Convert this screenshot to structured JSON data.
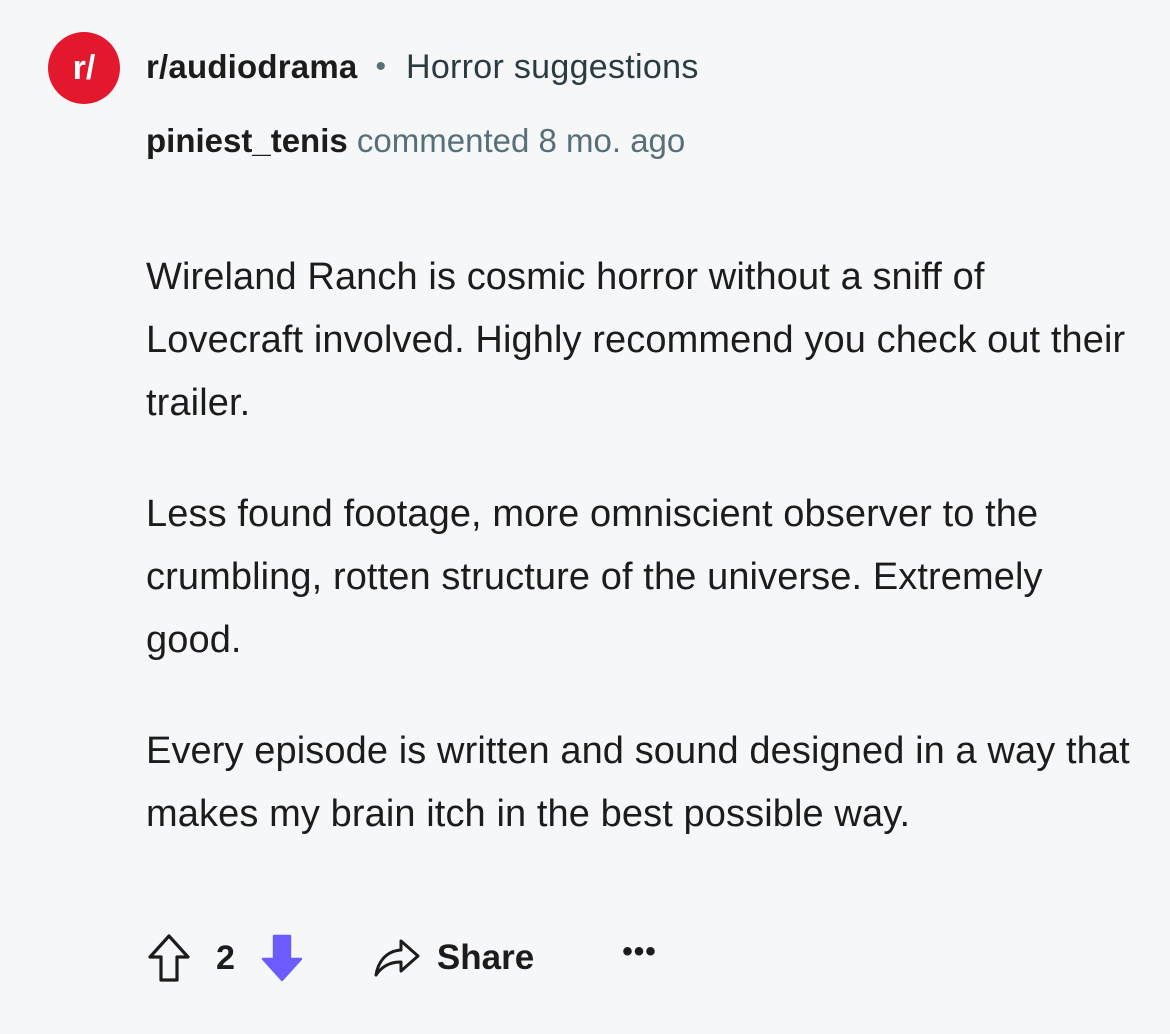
{
  "community": {
    "icon_text": "r/",
    "name": "r/audiodrama",
    "separator": "•",
    "post_title": "Horror suggestions",
    "accent_color": "#e3182d"
  },
  "comment": {
    "author": "piniest_tenis",
    "action": "commented",
    "age": "8 mo. ago",
    "paragraphs": [
      "Wireland Ranch is cosmic horror without a sniff of Lovecraft involved. Highly recommend you check out their trailer.",
      "Less found footage, more omniscient observer to the crumbling, rotten structure of the universe. Extremely good.",
      "Every episode is written and sound designed in a way that makes my brain itch in the best possible way."
    ]
  },
  "actions": {
    "upvote_icon": "arrow-up-outline-icon",
    "vote_count": "2",
    "downvote_icon": "arrow-down-filled-icon",
    "downvote_color": "#6a5cff",
    "share_icon": "share-arrow-icon",
    "share_label": "Share",
    "more_label": "•••"
  }
}
